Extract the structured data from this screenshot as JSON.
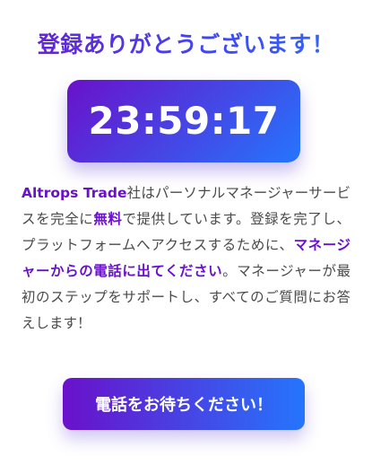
{
  "header": {
    "title": "登録ありがとうございます！"
  },
  "countdown": {
    "value": "23:59:17"
  },
  "description": {
    "brand": "Altrops Trade",
    "part1": "社はパーソナルマネージャーサービスを完全に",
    "free": "無料",
    "part2": "で提供しています。登録を完了し、プラットフォームへアクセスするために、",
    "call_emphasis": "マネージャーからの電話に出てください",
    "part3": "。マネージャーが最初のステップをサポートし、すべてのご質問にお答えします！"
  },
  "cta": {
    "label": "電話をお待ちください！"
  },
  "colors": {
    "accent_purple": "#6a11cb",
    "accent_blue": "#2575fc",
    "text": "#4a4a4a",
    "background": "#ffffff"
  }
}
